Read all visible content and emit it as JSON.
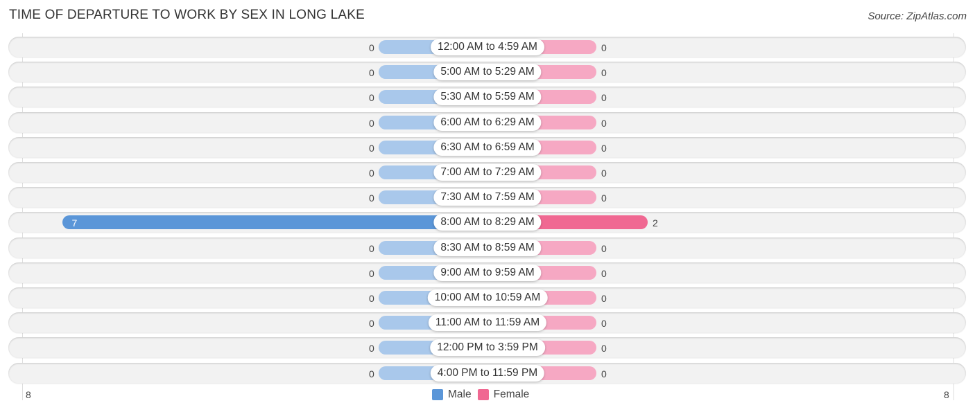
{
  "header": {
    "title": "TIME OF DEPARTURE TO WORK BY SEX IN LONG LAKE",
    "source": "Source: ZipAtlas.com"
  },
  "colors": {
    "male": "#5b96d8",
    "male_light": "#a9c8eb",
    "female": "#f06892",
    "female_light": "#f6a8c3"
  },
  "chart_data": {
    "type": "bar",
    "orientation": "horizontal-diverging",
    "title": "TIME OF DEPARTURE TO WORK BY SEX IN LONG LAKE",
    "categories": [
      "12:00 AM to 4:59 AM",
      "5:00 AM to 5:29 AM",
      "5:30 AM to 5:59 AM",
      "6:00 AM to 6:29 AM",
      "6:30 AM to 6:59 AM",
      "7:00 AM to 7:29 AM",
      "7:30 AM to 7:59 AM",
      "8:00 AM to 8:29 AM",
      "8:30 AM to 8:59 AM",
      "9:00 AM to 9:59 AM",
      "10:00 AM to 10:59 AM",
      "11:00 AM to 11:59 AM",
      "12:00 PM to 3:59 PM",
      "4:00 PM to 11:59 PM"
    ],
    "series": [
      {
        "name": "Male",
        "values": [
          0,
          0,
          0,
          0,
          0,
          0,
          0,
          7,
          0,
          0,
          0,
          0,
          0,
          0
        ]
      },
      {
        "name": "Female",
        "values": [
          0,
          0,
          0,
          0,
          0,
          0,
          0,
          2,
          0,
          0,
          0,
          0,
          0,
          0
        ]
      }
    ],
    "xlim": [
      -8,
      8
    ],
    "axis_labels": {
      "left": "8",
      "right": "8"
    },
    "legend": {
      "position": "bottom-center",
      "entries": [
        "Male",
        "Female"
      ]
    }
  }
}
